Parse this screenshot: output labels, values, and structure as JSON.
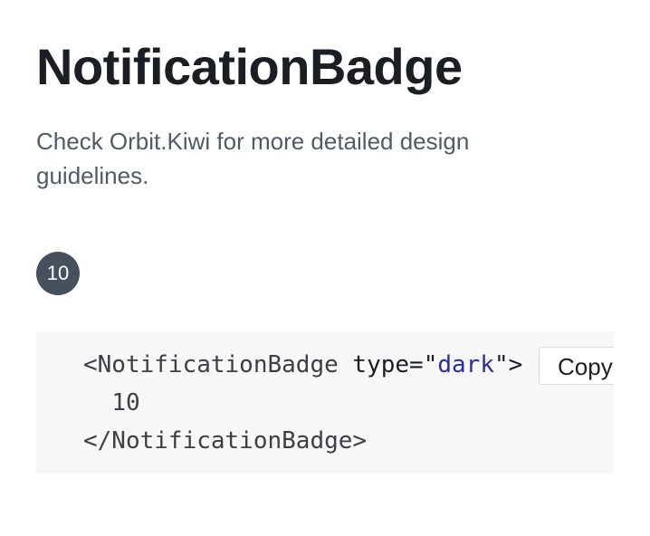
{
  "header": {
    "title": "NotificationBadge"
  },
  "description": {
    "prefix": "Check ",
    "link_text": "Orbit.Kiwi",
    "suffix": " for more detailed design guidelines."
  },
  "example": {
    "badge_value": "10",
    "badge_color": "#46515e"
  },
  "code_example": {
    "open_tag_start": "<NotificationBadge ",
    "attr_name": "type",
    "attr_eq": "=\"",
    "attr_value": "dark",
    "attr_close": "\">",
    "content": "10",
    "close_tag": "</NotificationBadge>",
    "copy_label": "Copy"
  }
}
